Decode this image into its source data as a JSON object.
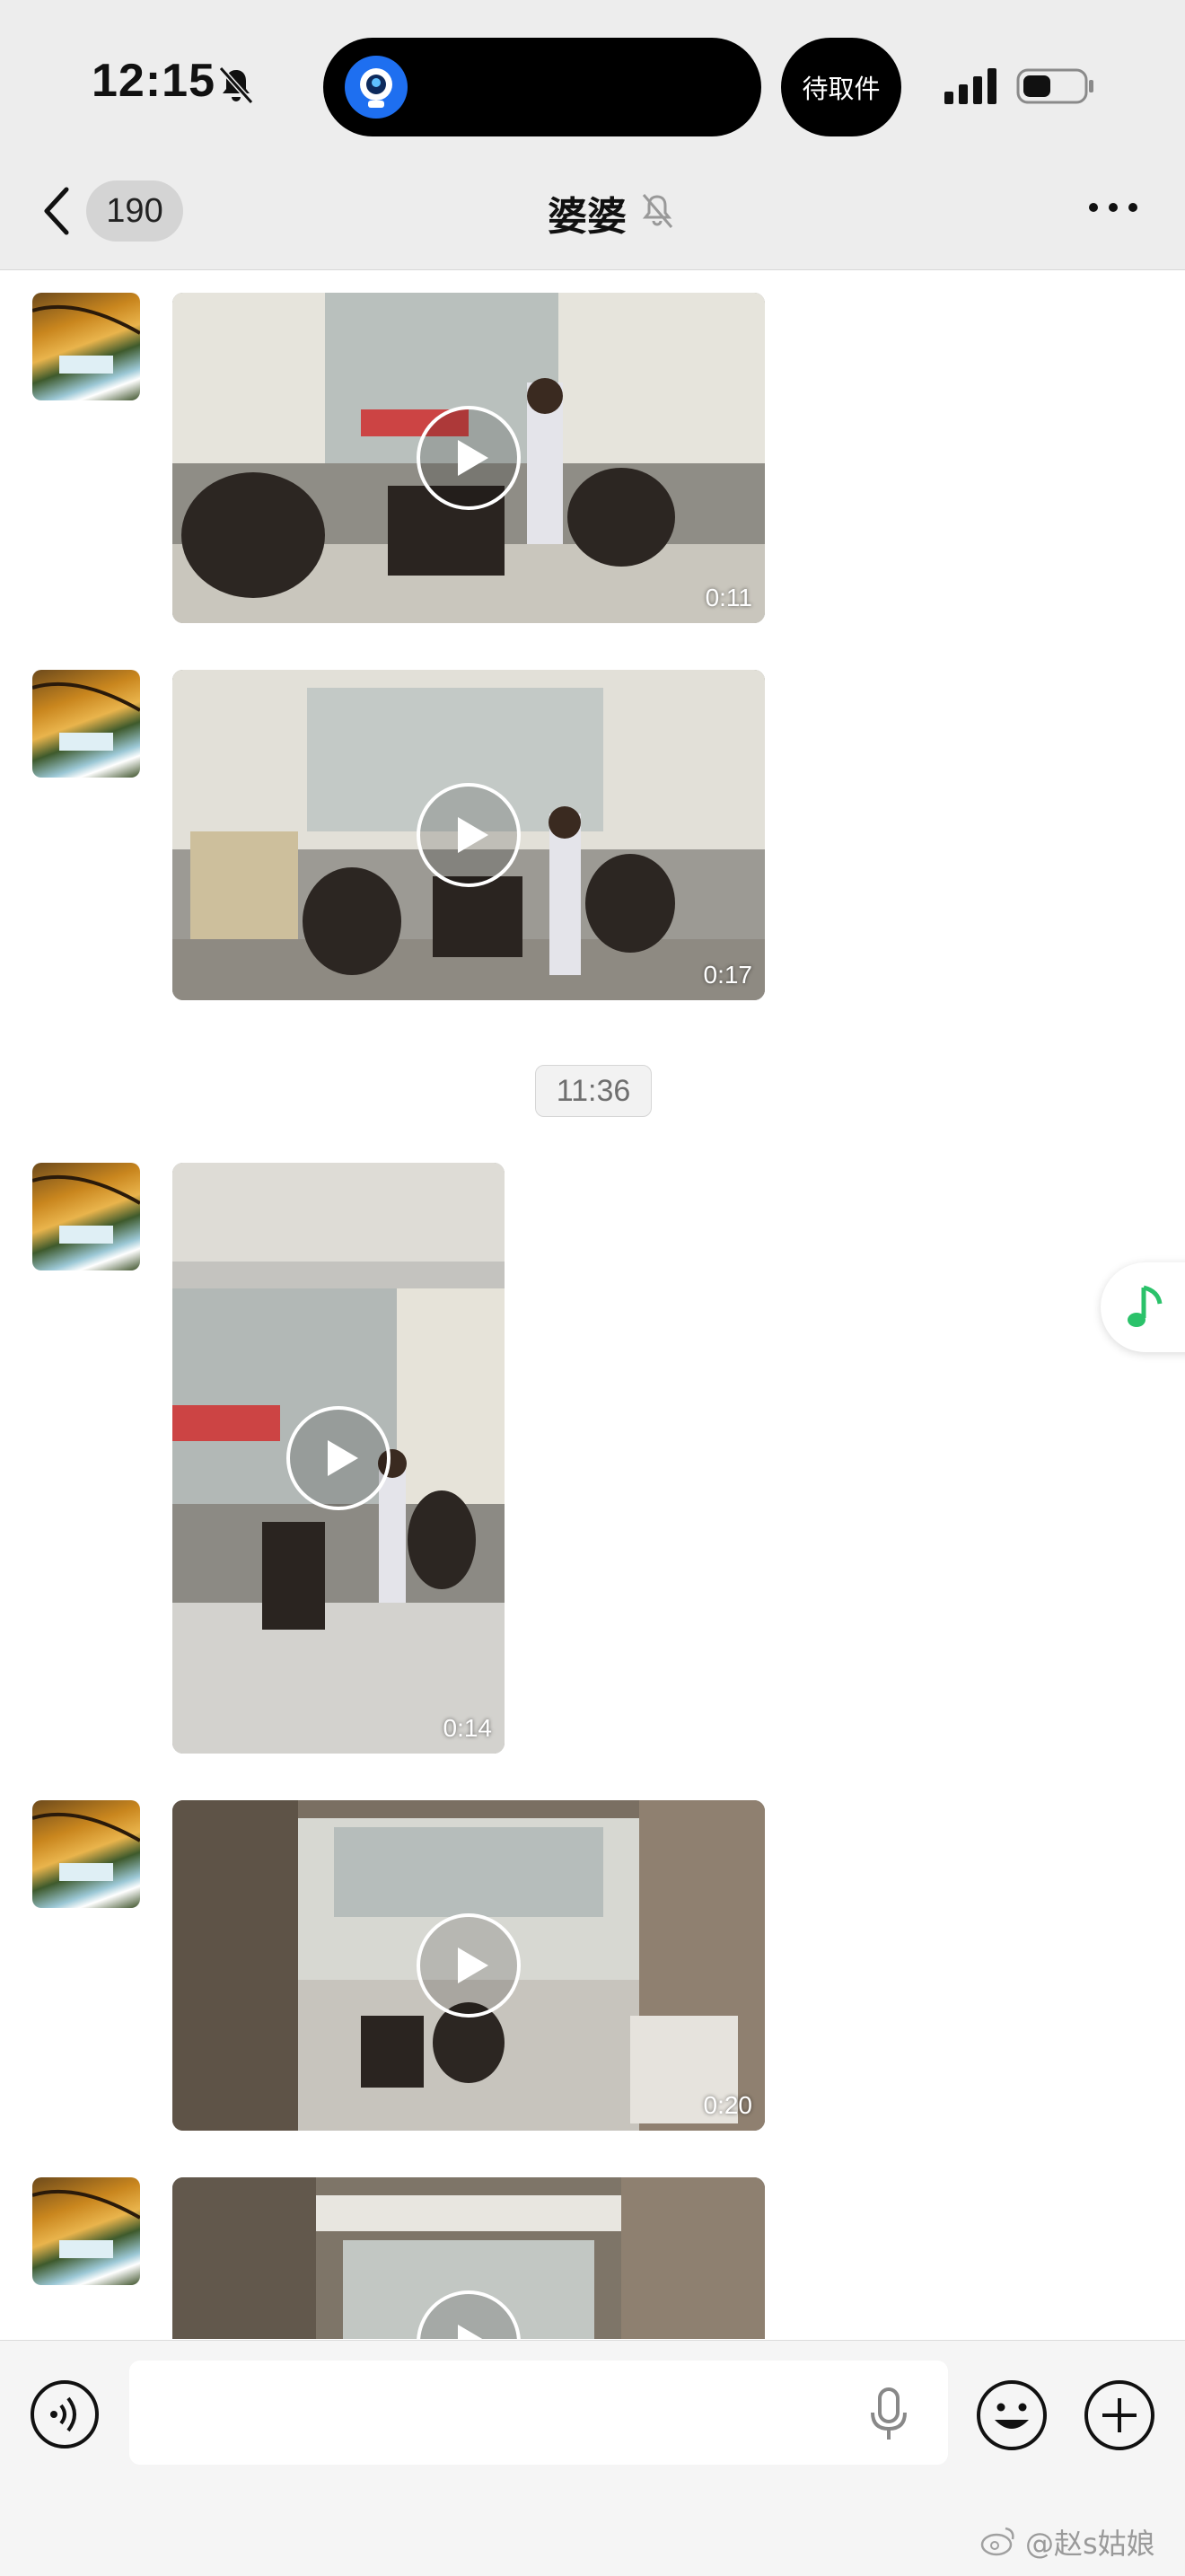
{
  "status_bar": {
    "time": "12:15",
    "pickup_label": "待取件"
  },
  "nav": {
    "unread_count": "190",
    "title": "婆婆"
  },
  "messages": [
    {
      "type": "video",
      "duration": "0:11"
    },
    {
      "type": "video",
      "duration": "0:17"
    },
    {
      "type": "timestamp",
      "text": "11:36"
    },
    {
      "type": "video",
      "duration": "0:14"
    },
    {
      "type": "video",
      "duration": "0:20"
    },
    {
      "type": "video",
      "duration": ""
    }
  ],
  "input_bar": {
    "placeholder": ""
  },
  "watermark": "@赵s姑娘",
  "colors": {
    "background": "#ffffff",
    "header_bg": "#ededed",
    "input_bar_bg": "#f5f5f5",
    "music_accent": "#2bc26a"
  }
}
